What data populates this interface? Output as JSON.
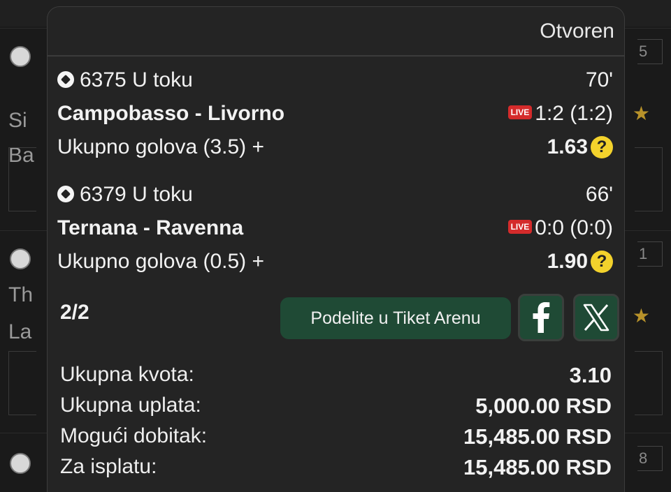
{
  "background": {
    "rows": [
      {
        "text_line1": "Si",
        "text_line2": "Ba",
        "num": "5"
      },
      {
        "text_line1": "Th",
        "text_line2": "La",
        "num": "1"
      },
      {
        "num": "8"
      }
    ]
  },
  "ticket": {
    "status": "Otvoren",
    "matches": [
      {
        "code_status": "6375 U toku",
        "minute": "70'",
        "teams": "Campobasso - Livorno",
        "live_label": "LIVE",
        "score": "1:2 (1:2)",
        "bet": "Ukupno golova (3.5) +",
        "odd": "1.63",
        "help": "?"
      },
      {
        "code_status": "6379 U toku",
        "minute": "66'",
        "teams": "Ternana - Ravenna",
        "live_label": "LIVE",
        "score": "0:0 (0:0)",
        "bet": "Ukupno golova (0.5) +",
        "odd": "1.90",
        "help": "?"
      }
    ],
    "counter": "2/2",
    "share_label": "Podelite u Tiket Arenu",
    "summary": [
      {
        "label": "Ukupna kvota:",
        "value": "3.10"
      },
      {
        "label": "Ukupna uplata:",
        "value": "5,000.00 RSD"
      },
      {
        "label": "Mogući dobitak:",
        "value": "15,485.00 RSD"
      },
      {
        "label": "Za isplatu:",
        "value": "15,485.00 RSD"
      }
    ]
  },
  "colors": {
    "accent_green": "#1f4a35",
    "live_red": "#d42b2b",
    "help_yellow": "#f3d22c",
    "star_gold": "#b8922a"
  }
}
